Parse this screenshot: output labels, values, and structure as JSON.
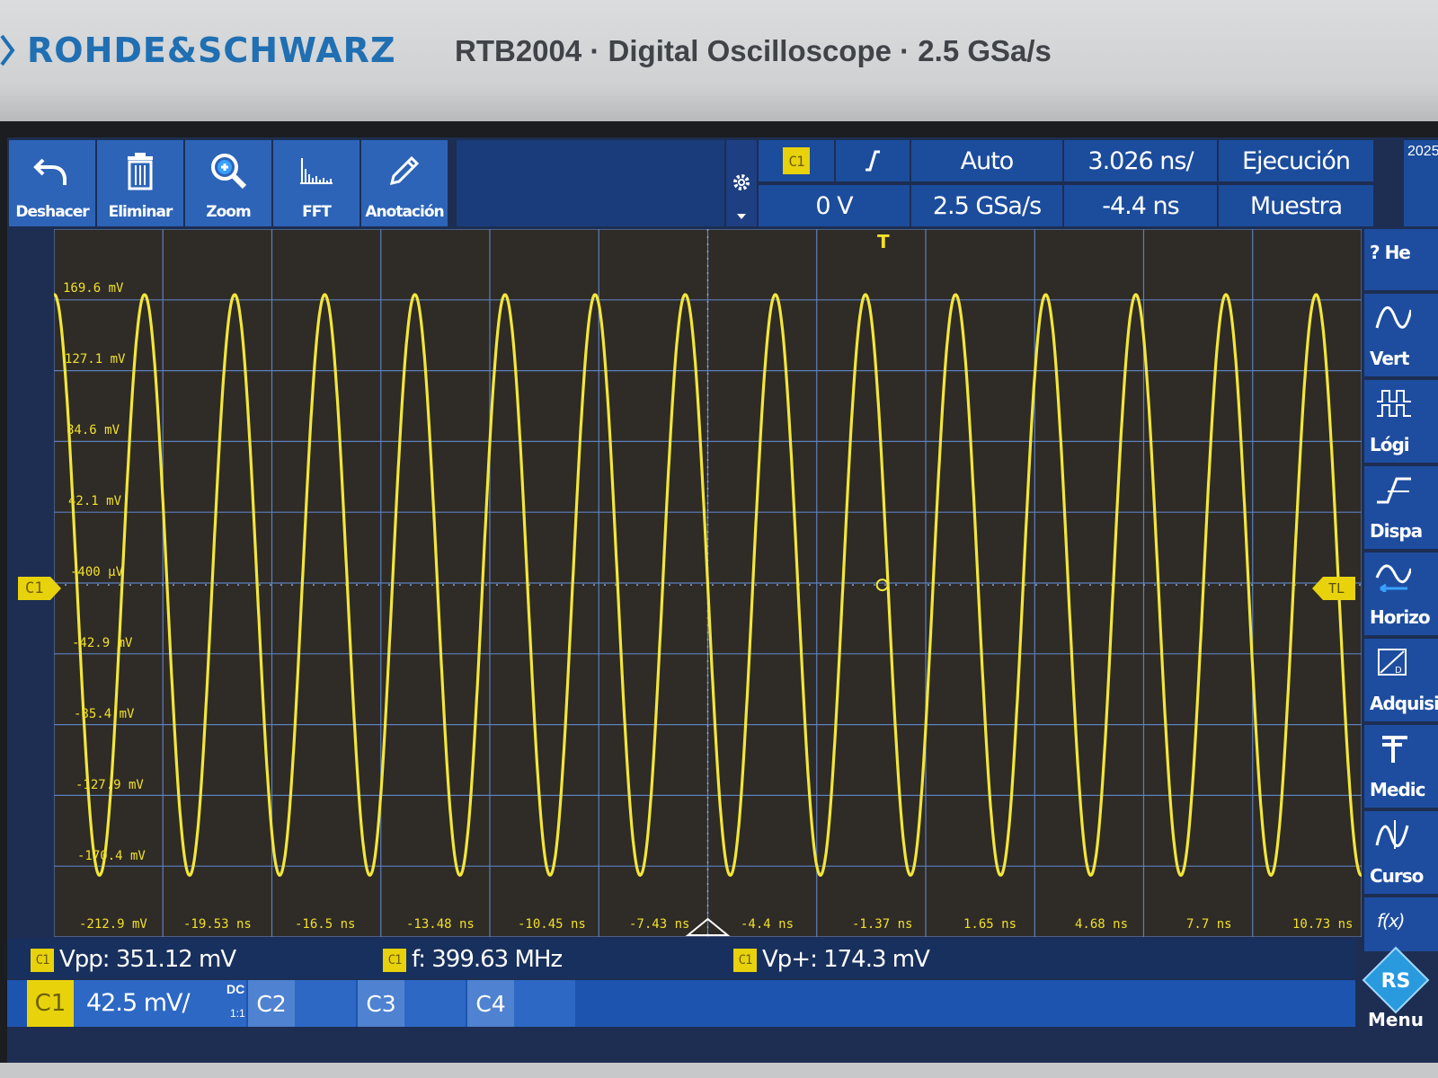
{
  "header": {
    "brand": "ROHDE&SCHWARZ",
    "model": "RTB2004 · Digital Oscilloscope · 2.5 GSa/s"
  },
  "toolbar": {
    "undo_label": "Deshacer",
    "delete_label": "Eliminar",
    "zoom_label": "Zoom",
    "fft_label": "FFT",
    "annotation_label": "Anotación"
  },
  "status": {
    "trigger_source": "C1",
    "trigger_level": "0 V",
    "trigger_mode": "Auto",
    "sample_rate": "2.5 GSa/s",
    "time_per_div": "3.026 ns/",
    "horizontal_position": "-4.4 ns",
    "run_state": "Ejecución",
    "acquisition_mode": "Muestra",
    "date_fragment": "2025-"
  },
  "grid": {
    "y_labels": [
      "169.6 mV",
      "127.1 mV",
      "84.6 mV",
      "42.1 mV",
      "-400 µV",
      "-42.9 mV",
      "-85.4 mV",
      "-127.9 mV",
      "-170.4 mV",
      "-212.9 mV"
    ],
    "x_labels": [
      "-19.53 ns",
      "-16.5 ns",
      "-13.48 ns",
      "-10.45 ns",
      "-7.43 ns",
      "-4.4 ns",
      "-1.37 ns",
      "1.65 ns",
      "4.68 ns",
      "7.7 ns",
      "10.73 ns"
    ],
    "c1_marker": "C1",
    "tl_marker": "TL",
    "trigger_marker": "T"
  },
  "waveform": {
    "channel": "C1",
    "color": "#f2e63a",
    "frequency_mhz": 399.63,
    "amplitude_mv": 174.3,
    "offset_mv": -0.4
  },
  "measurements": [
    {
      "channel": "C1",
      "text": "Vpp: 351.12 mV"
    },
    {
      "channel": "C1",
      "text": "f: 399.63 MHz"
    },
    {
      "channel": "C1",
      "text": "Vp+: 174.3 mV"
    }
  ],
  "channels": {
    "c1_label": "C1",
    "c1_scale": "42.5 mV/",
    "c1_coupling": "DC",
    "c1_ratio": "1:1",
    "c2_label": "C2",
    "c3_label": "C3",
    "c4_label": "C4"
  },
  "side_menu": {
    "help": "? He",
    "vertical": "Vert",
    "logic": "Lógi",
    "trigger": "Dispa",
    "horizontal": "Horizo",
    "acquisition": "Adquisi",
    "measure": "Medic",
    "cursor": "Curso",
    "math": "f(x)",
    "menu": "Menu"
  },
  "colors": {
    "brand": "#1f6fb2",
    "trace": "#f2e63a",
    "button_blue": "#2d64b8",
    "screen_bg": "#1d2e52",
    "channel1": "#e8d20c"
  }
}
